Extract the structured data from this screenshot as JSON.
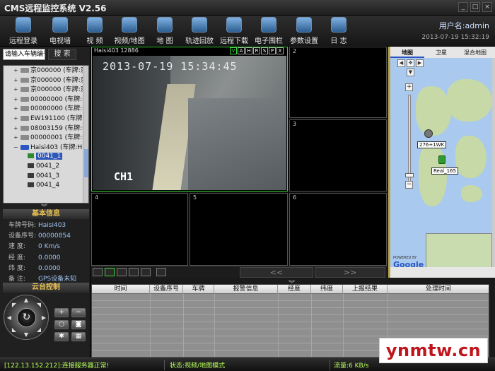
{
  "window": {
    "title": "CMS远程监控系统 V2.56"
  },
  "toolbar": {
    "items": [
      {
        "label": "远程登录",
        "icon": "login-icon"
      },
      {
        "label": "电视墙",
        "icon": "tv-wall-icon"
      },
      {
        "label": "视 频",
        "icon": "video-icon"
      },
      {
        "label": "视频/地图",
        "icon": "video-map-icon"
      },
      {
        "label": "地 图",
        "icon": "map-icon"
      },
      {
        "label": "轨迹回放",
        "icon": "track-playback-icon"
      },
      {
        "label": "远程下载",
        "icon": "remote-download-icon"
      },
      {
        "label": "电子围栏",
        "icon": "geofence-icon"
      },
      {
        "label": "参数设置",
        "icon": "settings-icon"
      },
      {
        "label": "日 志",
        "icon": "log-icon"
      }
    ],
    "user": "用户名:admin",
    "datetime": "2013-07-19 15:32:19"
  },
  "search": {
    "placeholder": "请输入车辆编号",
    "button": "搜 索"
  },
  "tree": {
    "vehicles": [
      "京000000 (车牌:京",
      "京000000 (车牌:京",
      "京000000 (车牌:京",
      "00000000 (车牌:00",
      "00000000 (车牌:00",
      "EW191100 (车牌:EW",
      "08003159 (车牌:08",
      "00000001 (车牌:00"
    ],
    "open_vehicle": "Haisi403 (车牌:Ha",
    "channels": [
      "0041_1",
      "0041_2",
      "0041_3",
      "0041_4"
    ]
  },
  "basic_info": {
    "title": "基本信息",
    "rows": [
      {
        "k": "车牌号码:",
        "v": "Haisi403"
      },
      {
        "k": "设备序号:",
        "v": "00000854"
      },
      {
        "k": "速   度:",
        "v": "0 Km/s"
      },
      {
        "k": "经   度:",
        "v": "0.0000"
      },
      {
        "k": "纬   度:",
        "v": "0.0000"
      },
      {
        "k": "备   注:",
        "v": "GPS设备未知"
      }
    ]
  },
  "ptz": {
    "title": "云台控制"
  },
  "video": {
    "camera_name": "Haisi403   12886",
    "cam_buttons": [
      "V",
      "A",
      "H",
      "R",
      "S",
      "P",
      "X"
    ],
    "osd_time": "2013-07-19  15:34:45",
    "channel_label": "CH1",
    "cell_numbers": [
      "2",
      "3",
      "4",
      "5",
      "6"
    ],
    "prev": "<<",
    "next": ">>"
  },
  "map": {
    "tabs": [
      "地图",
      "卫星",
      "混合地图"
    ],
    "label1": "276+1WK",
    "label2": "Real_165",
    "powered": "POWERED BY",
    "brand": "Google"
  },
  "alarm_table": {
    "headers": [
      "时间",
      "设备序号",
      "车牌",
      "报警信息",
      "经度",
      "纬度",
      "上报结果",
      "处理时间"
    ]
  },
  "statusbar": {
    "server": "[122.13.152.212]:连接服务器正常!",
    "mode": "状态:视频/地图模式",
    "traffic": "流量:6 KB/s"
  },
  "watermark": "ynmtw.cn"
}
